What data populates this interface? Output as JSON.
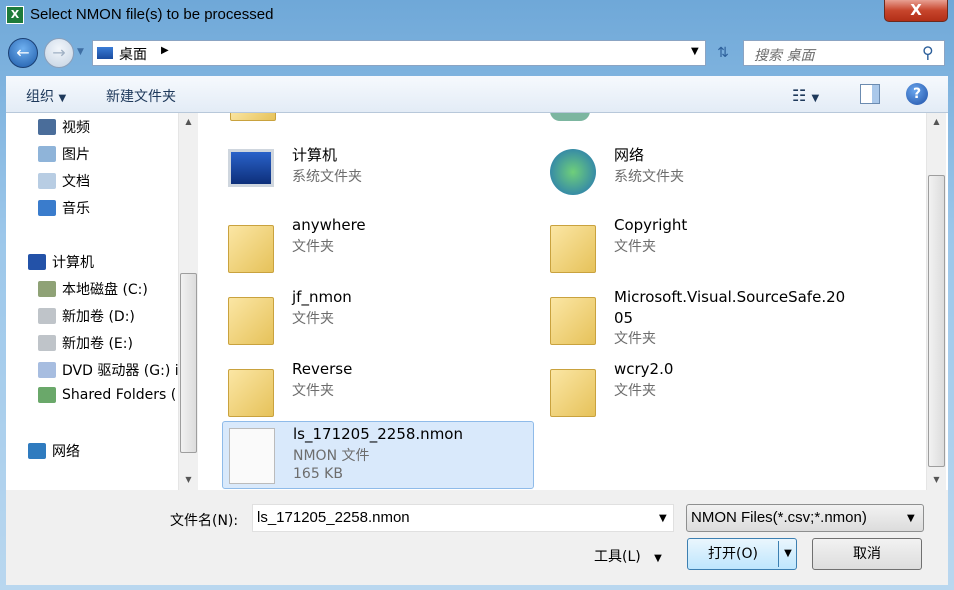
{
  "window": {
    "title": "Select NMON file(s) to be processed",
    "close_label": "X"
  },
  "address": {
    "location": "桌面",
    "search_placeholder": "搜索 桌面"
  },
  "toolbar": {
    "organize": "组织",
    "new_folder": "新建文件夹"
  },
  "nav": {
    "items": [
      {
        "label": "视频",
        "icon": "video-library-icon",
        "color": "#4a6d9a"
      },
      {
        "label": "图片",
        "icon": "pictures-library-icon",
        "color": "#8fb4d9"
      },
      {
        "label": "文档",
        "icon": "documents-library-icon",
        "color": "#b8cde3"
      },
      {
        "label": "音乐",
        "icon": "music-library-icon",
        "color": "#3a7ccc"
      },
      {
        "label": "计算机",
        "icon": "computer-icon",
        "color": "#2352a8"
      },
      {
        "label": "本地磁盘 (C:)",
        "icon": "local-disk-icon",
        "color": "#8fa276"
      },
      {
        "label": "新加卷 (D:)",
        "icon": "drive-icon",
        "color": "#bfc4c9"
      },
      {
        "label": "新加卷 (E:)",
        "icon": "drive-icon",
        "color": "#bfc4c9"
      },
      {
        "label": "DVD 驱动器 (G:) i",
        "icon": "dvd-drive-icon",
        "color": "#a7bde0"
      },
      {
        "label": "Shared Folders (",
        "icon": "shared-folder-icon",
        "color": "#6aa86a"
      },
      {
        "label": "网络",
        "icon": "network-icon",
        "color": "#2f7bbf"
      }
    ]
  },
  "files": [
    {
      "name": "计算机",
      "type": "系统文件夹",
      "icon": "computer-icon"
    },
    {
      "name": "网络",
      "type": "系统文件夹",
      "icon": "network-icon"
    },
    {
      "name": "anywhere",
      "type": "文件夹",
      "icon": "folder-icon"
    },
    {
      "name": "Copyright",
      "type": "文件夹",
      "icon": "folder-icon"
    },
    {
      "name": "jf_nmon",
      "type": "文件夹",
      "icon": "folder-icon"
    },
    {
      "name": "Microsoft.Visual.SourceSafe.2005",
      "type": "文件夹",
      "icon": "folder-icon"
    },
    {
      "name": "Reverse",
      "type": "文件夹",
      "icon": "folder-icon"
    },
    {
      "name": "wcry2.0",
      "type": "文件夹",
      "icon": "folder-icon"
    },
    {
      "name": "ls_171205_2258.nmon",
      "type": "NMON 文件",
      "size": "165 KB",
      "icon": "file-icon",
      "selected": true
    }
  ],
  "bottom": {
    "filename_label": "文件名(N):",
    "filename_value": "ls_171205_2258.nmon",
    "filter": "NMON Files(*.csv;*.nmon)",
    "tools": "工具(L)",
    "open": "打开(O)",
    "cancel": "取消"
  }
}
